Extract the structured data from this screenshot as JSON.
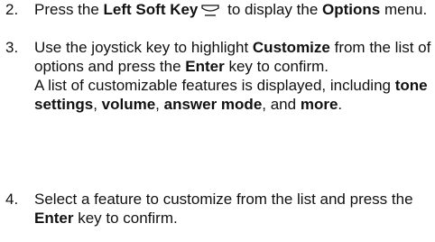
{
  "steps": [
    {
      "number": "2.",
      "parts": {
        "a": "Press the ",
        "b": "Left Soft Key",
        "c": " to display the ",
        "d": "Options",
        "e": " menu."
      },
      "icon": "left-soft-key-icon"
    },
    {
      "number": "3.",
      "parts": {
        "a": "Use the joystick key to highlight ",
        "b": "Customize",
        "c": " from the list of options and press the ",
        "d": "Enter",
        "e": " key to confirm."
      },
      "note": {
        "a": "A list of customizable features is displayed, including ",
        "b": "tone settings",
        "c": ", ",
        "d": "volume",
        "e": ", ",
        "f": "answer mode",
        "g": ", and ",
        "h": "more",
        "i": "."
      }
    },
    {
      "number": "4.",
      "parts": {
        "a": "Select a feature to customize from the list and press the ",
        "b": "Enter",
        "c": " key to confirm."
      }
    }
  ]
}
